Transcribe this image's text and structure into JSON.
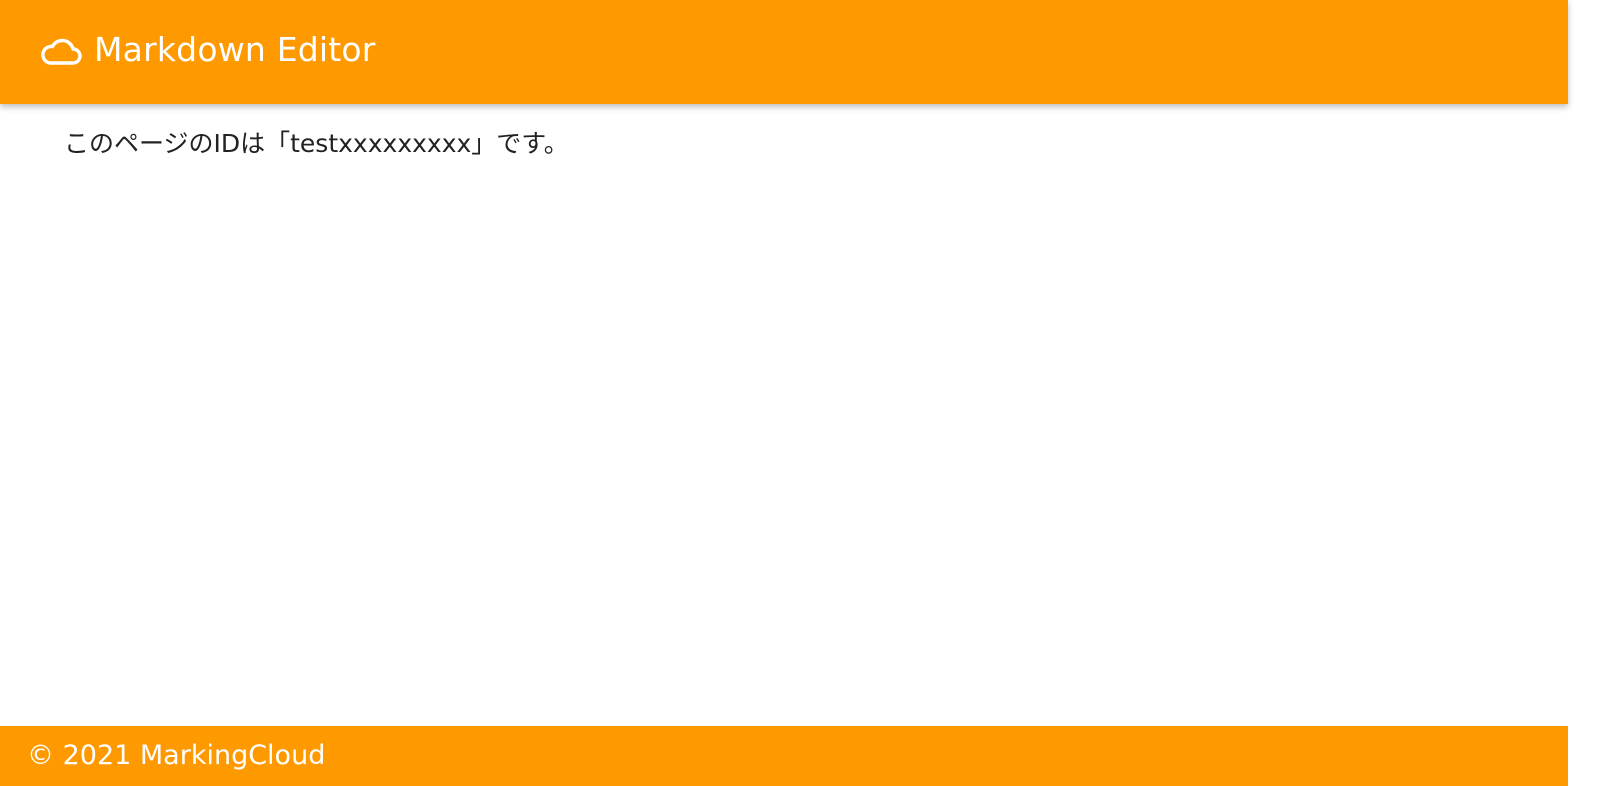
{
  "header": {
    "icon": "cloud-icon",
    "title": "Markdown Editor"
  },
  "main": {
    "message": "このページのIDは「testxxxxxxxxx」です。"
  },
  "footer": {
    "copyright": "© 2021 MarkingCloud"
  },
  "colors": {
    "brand": "#ff9900",
    "header_text": "#ffffff",
    "body_text": "#222222"
  }
}
